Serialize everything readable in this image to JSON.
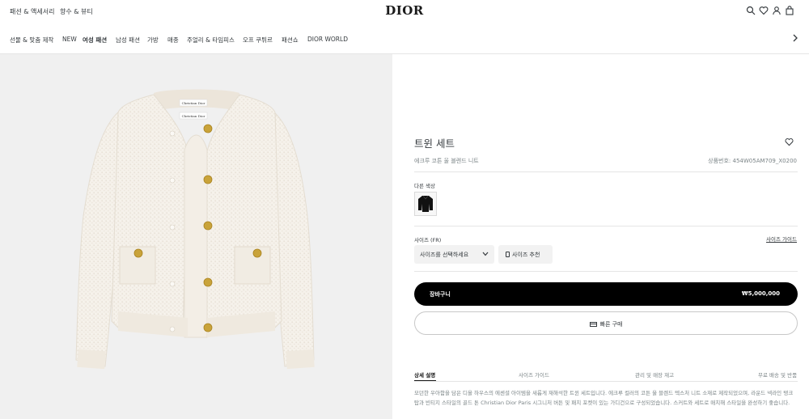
{
  "header": {
    "links": [
      "패션 & 액세서리",
      "향수 & 뷰티"
    ],
    "logo": "DIOR",
    "icons": [
      "search-icon",
      "heart-icon",
      "user-icon",
      "bag-icon"
    ]
  },
  "nav": {
    "items": [
      "선물 & 맞춤 제작",
      "NEW",
      "여성 패션",
      "남성 패션",
      "가방",
      "매종",
      "주얼리 & 타임피스",
      "오프 쿠튀르",
      "패션쇼",
      "DIOR WORLD"
    ],
    "active": "여성 패션"
  },
  "product": {
    "title": "트윈 세트",
    "subtitle": "에크루 코튼 울 블렌드 니트",
    "ref": "상품번호: 454W05AM709_X0200",
    "colors_label": "다른 색상",
    "size_label": "사이즈 (FR)",
    "size_guide": "사이즈 가이드",
    "size_select_placeholder": "사이즈를 선택하세요",
    "size_reco": "사이즈 추천",
    "cart_label": "장바구니",
    "price": "₩5,000,000",
    "fast_buy": "빠른 구매",
    "tabs": [
      "상세 설명",
      "사이즈 가이드",
      "관리 및 매장 재고",
      "무료 배송 및 반품"
    ],
    "description": "모던한 우아함을 담은 디올 하우스의 에센셜 아이템을 새롭게 재해석한 트윈 세트입니다. 에크루 컬러의 코튼 울 블렌드 텍스처 니트 소재로 제작되었으며, 라운드 넥라인 탱크탑과 빈티지 스타일의 골드 톤 Christian Dior Paris 시그니처 버튼 및 패치 포켓이 있는 가디건으로 구성되었습니다. 스커트와 세트로 매치해 스타일을 완성하기 좋습니다.",
    "label_tag": "Christian Dior"
  },
  "colors": {
    "image_bg": "#f0f0f0",
    "knit": "#f5f1ea",
    "button_gold": "#c9a33a",
    "accent": "#000000"
  }
}
